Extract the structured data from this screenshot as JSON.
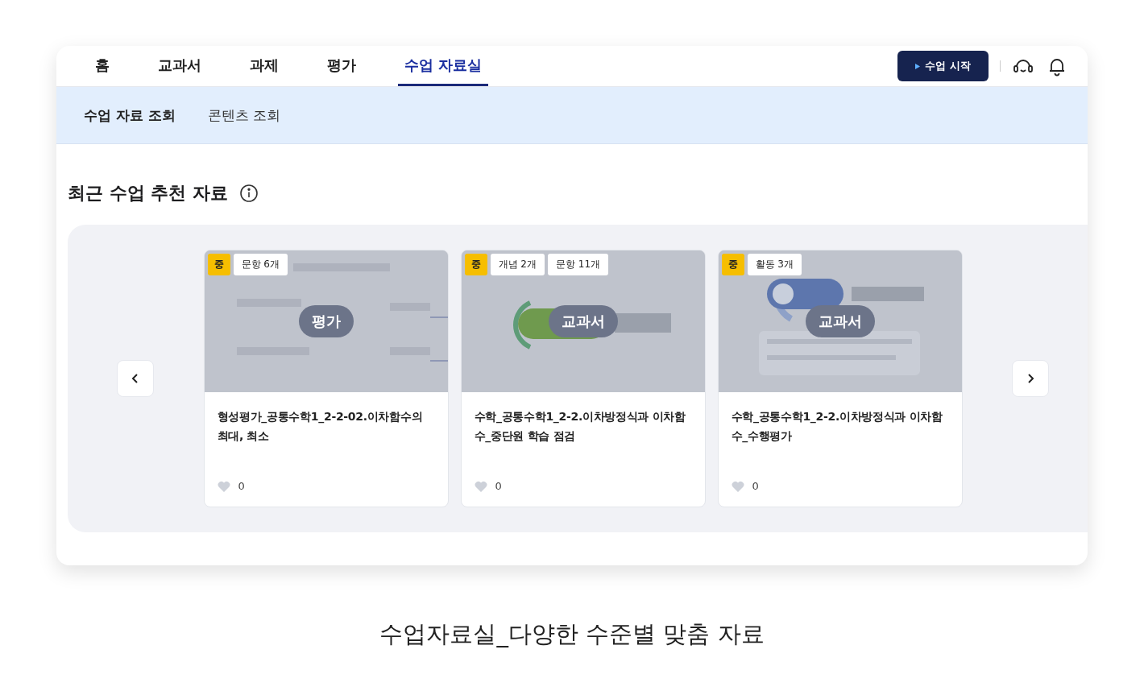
{
  "nav": {
    "tabs": [
      {
        "label": "홈",
        "selected": false
      },
      {
        "label": "교과서",
        "selected": false
      },
      {
        "label": "과제",
        "selected": false
      },
      {
        "label": "평가",
        "selected": false
      },
      {
        "label": "수업 자료실",
        "selected": true
      }
    ],
    "start_button": "수업 시작"
  },
  "subnav": {
    "items": [
      {
        "label": "수업 자료 조회",
        "selected": true
      },
      {
        "label": "콘텐츠 조회",
        "selected": false
      }
    ]
  },
  "section": {
    "title": "최근 수업 추천 자료"
  },
  "cards": [
    {
      "level": "중",
      "tags": [
        "문항 6개"
      ],
      "thumbnail": {
        "kind": "picture"
      },
      "category": "평가",
      "title": "형성평가_공통수학1_2-2-02.이차함수의 최대, 최소",
      "likes": "0"
    },
    {
      "level": "중",
      "tags": [
        "개념 2개",
        "문항 11개"
      ],
      "thumbnail": {
        "kind": "picture"
      },
      "category": "교과서",
      "title": "수학_공통수학1_2-2.이차방정식과 이차함수_중단원 학습 점검",
      "likes": "0"
    },
    {
      "level": "중",
      "tags": [
        "활동 3개"
      ],
      "thumbnail": {
        "kind": "picture"
      },
      "category": "교과서",
      "title": "수학_공통수학1_2-2.이차방정식과 이차함수_수행평가",
      "likes": "0"
    }
  ],
  "caption": "수업자료실_다양한 수준별 맞춤 자료"
}
